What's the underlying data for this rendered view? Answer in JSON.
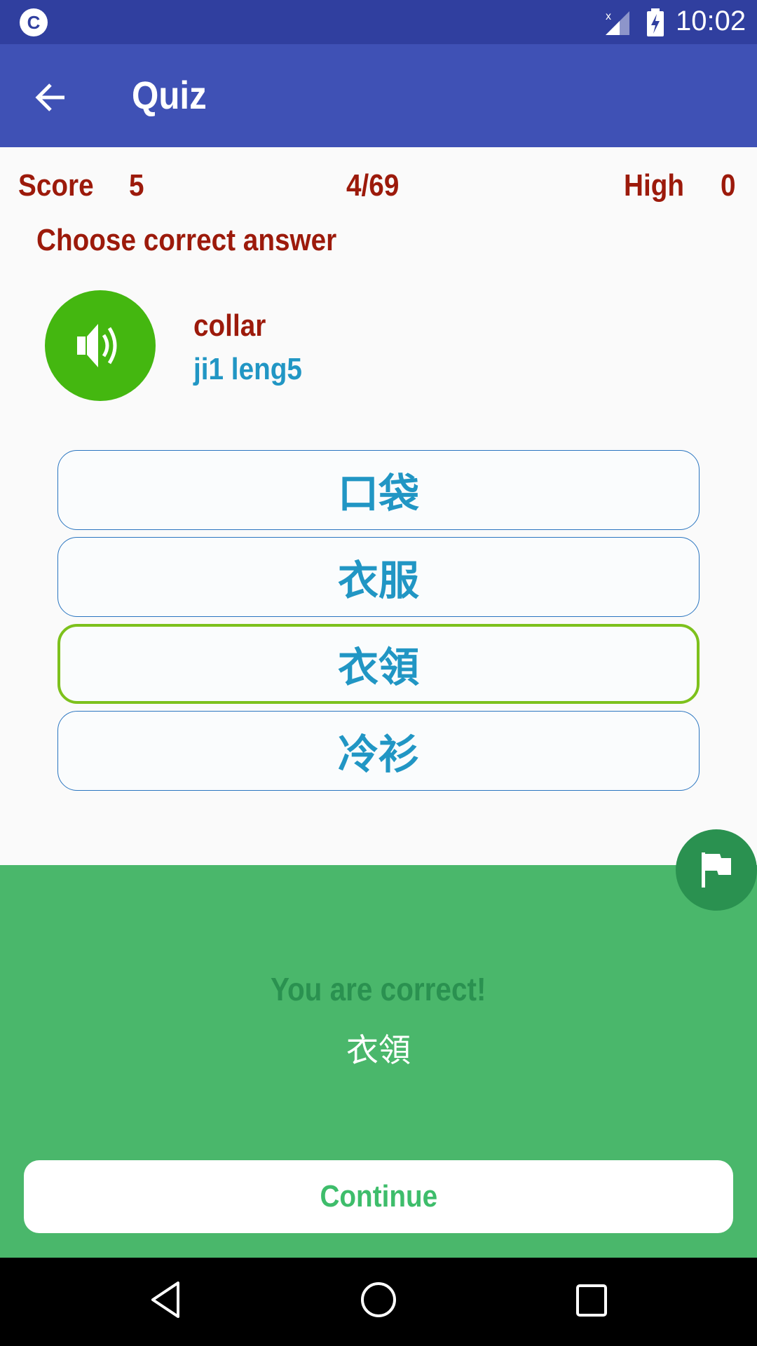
{
  "status_bar": {
    "notification_icon": "app-c-icon",
    "notification_letter": "C",
    "signal_icon": "signal-no-data-icon",
    "battery_icon": "battery-charging-icon",
    "time": "10:02"
  },
  "app_bar": {
    "back_icon": "arrow-back-icon",
    "title": "Quiz"
  },
  "score_row": {
    "score_label": "Score",
    "score_value": "5",
    "progress": "4/69",
    "high_label": "High",
    "high_value": "0"
  },
  "question": {
    "prompt": "Choose correct answer",
    "speaker_icon": "volume-up-icon",
    "word": "collar",
    "pinyin": "ji1 leng5"
  },
  "options": [
    {
      "label": "口袋",
      "selected": false
    },
    {
      "label": "衣服",
      "selected": false
    },
    {
      "label": "衣領",
      "selected": true
    },
    {
      "label": "冷衫",
      "selected": false
    }
  ],
  "result": {
    "flag_icon": "flag-icon",
    "title": "You are correct!",
    "answer": "衣領",
    "continue_label": "Continue"
  },
  "nav_bar": {
    "back": "nav-back-icon",
    "home": "nav-home-icon",
    "recents": "nav-recents-icon"
  },
  "colors": {
    "status_bar": "#303f9f",
    "app_bar": "#3f51b5",
    "score_text": "#9c1a0b",
    "pinyin_text": "#2196c4",
    "speaker_button": "#44b710",
    "option_border": "#2a75c0",
    "selected_border": "#7dc11c",
    "result_panel": "#4ab76b",
    "result_title": "#2a9150",
    "continue_text": "#3ebd6b"
  }
}
